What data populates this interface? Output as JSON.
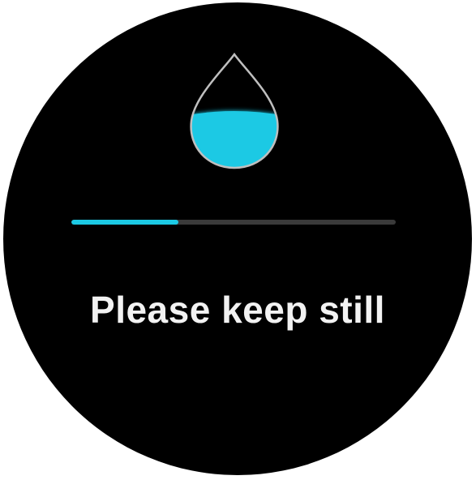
{
  "screen": {
    "message": "Please keep still",
    "icon": "water-drop-icon",
    "progress": 0.33
  },
  "colors": {
    "background": "#000000",
    "accent": "#1cc9e4",
    "track": "#3a3a3a",
    "text": "#f2f2f2"
  }
}
